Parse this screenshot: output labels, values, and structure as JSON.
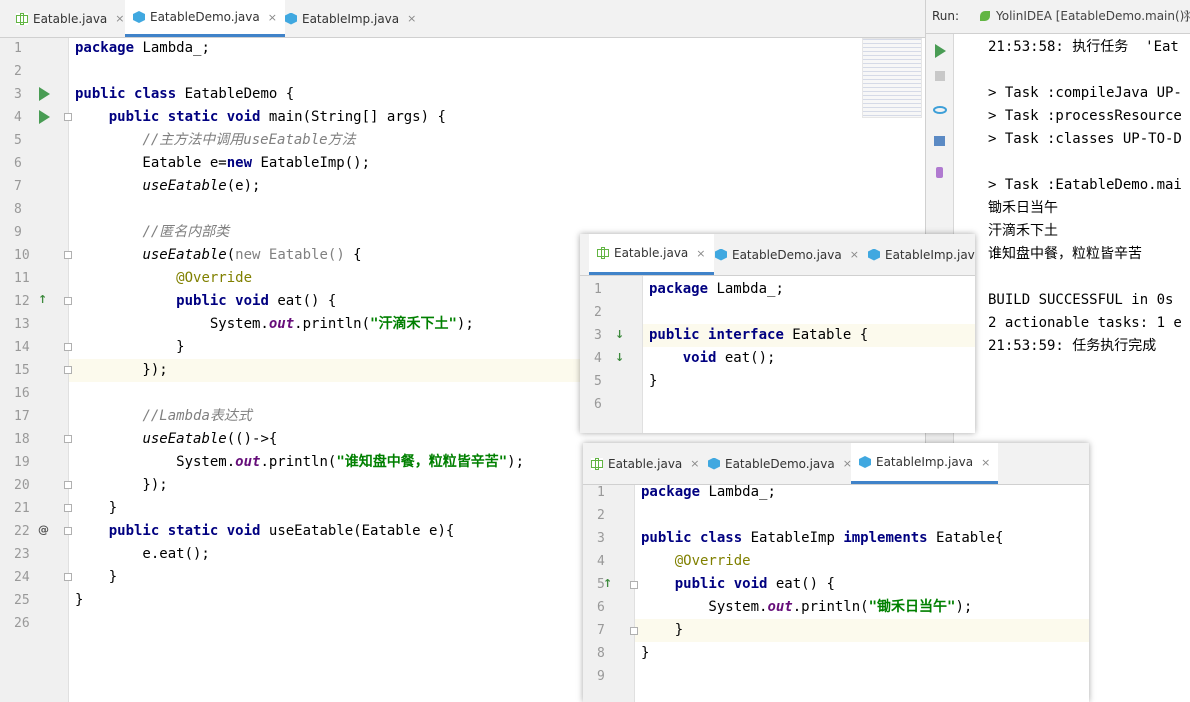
{
  "main_tabs": [
    {
      "label": "Eatable.java",
      "icon": "interface-icon",
      "active": false
    },
    {
      "label": "EatableDemo.java",
      "icon": "class-icon",
      "active": true
    },
    {
      "label": "EatableImp.java",
      "icon": "class-icon",
      "active": false
    }
  ],
  "close_glyph": "×",
  "run_panel": {
    "label": "Run:",
    "config": "YolinIDEA [EatableDemo.main()]",
    "close": "×"
  },
  "main_code": [
    "package Lambda_;",
    "",
    "public class EatableDemo {",
    "    public static void main(String[] args) {",
    "        //主方法中调用useEatable方法",
    "        Eatable e=new EatableImp();",
    "        useEatable(e);",
    "",
    "        //匿名内部类",
    "        useEatable(new Eatable() {",
    "            @Override",
    "            public void eat() {",
    "                System.out.println(\"汗滴禾下土\");",
    "            }",
    "        });",
    "",
    "        //Lambda表达式",
    "        useEatable(()->{",
    "            System.out.println(\"谁知盘中餐，粒粒皆辛苦\");",
    "        });",
    "    }",
    "    public static void useEatable(Eatable e){",
    "        e.eat();",
    "    }",
    "}",
    ""
  ],
  "main_line_numbers": [
    "1",
    "2",
    "3",
    "4",
    "5",
    "6",
    "7",
    "8",
    "9",
    "10",
    "11",
    "12",
    "13",
    "14",
    "15",
    "16",
    "17",
    "18",
    "19",
    "20",
    "21",
    "22",
    "23",
    "24",
    "25",
    "26"
  ],
  "console_lines": [
    "21:53:58: 执行任务  'Eat",
    "",
    "> Task :compileJava UP-",
    "> Task :processResource",
    "> Task :classes UP-TO-D",
    "",
    "> Task :EatableDemo.mai",
    "锄禾日当午",
    "汗滴禾下土",
    "谁知盘中餐，粒粒皆辛苦",
    "",
    "BUILD SUCCESSFUL in 0s",
    "2 actionable tasks: 1 e",
    "21:53:59: 任务执行完成"
  ],
  "win1": {
    "tabs": [
      {
        "label": "Eatable.java",
        "icon": "interface-icon",
        "active": true
      },
      {
        "label": "EatableDemo.java",
        "icon": "class-icon",
        "active": false
      },
      {
        "label": "EatableImp.java",
        "icon": "class-icon",
        "active": false
      }
    ],
    "line_numbers": [
      "1",
      "2",
      "3",
      "4",
      "5",
      "6"
    ],
    "code": [
      "package Lambda_;",
      "",
      "public interface Eatable {",
      "    void eat();",
      "}",
      ""
    ]
  },
  "win2": {
    "tabs": [
      {
        "label": "Eatable.java",
        "icon": "interface-icon",
        "active": false
      },
      {
        "label": "EatableDemo.java",
        "icon": "class-icon",
        "active": false
      },
      {
        "label": "EatableImp.java",
        "icon": "class-icon",
        "active": true
      }
    ],
    "line_numbers": [
      "1",
      "2",
      "3",
      "4",
      "5",
      "6",
      "7",
      "8",
      "9"
    ],
    "code": [
      "package Lambda_;",
      "",
      "public class EatableImp implements Eatable{",
      "    @Override",
      "    public void eat() {",
      "        System.out.println(\"锄禾日当午\");",
      "    }",
      "}",
      ""
    ]
  },
  "colors": {
    "keyword": "#000080",
    "string": "#008000",
    "comment": "#808080",
    "annotation": "#808000",
    "run": "#499c54",
    "accent": "#4083c9"
  }
}
